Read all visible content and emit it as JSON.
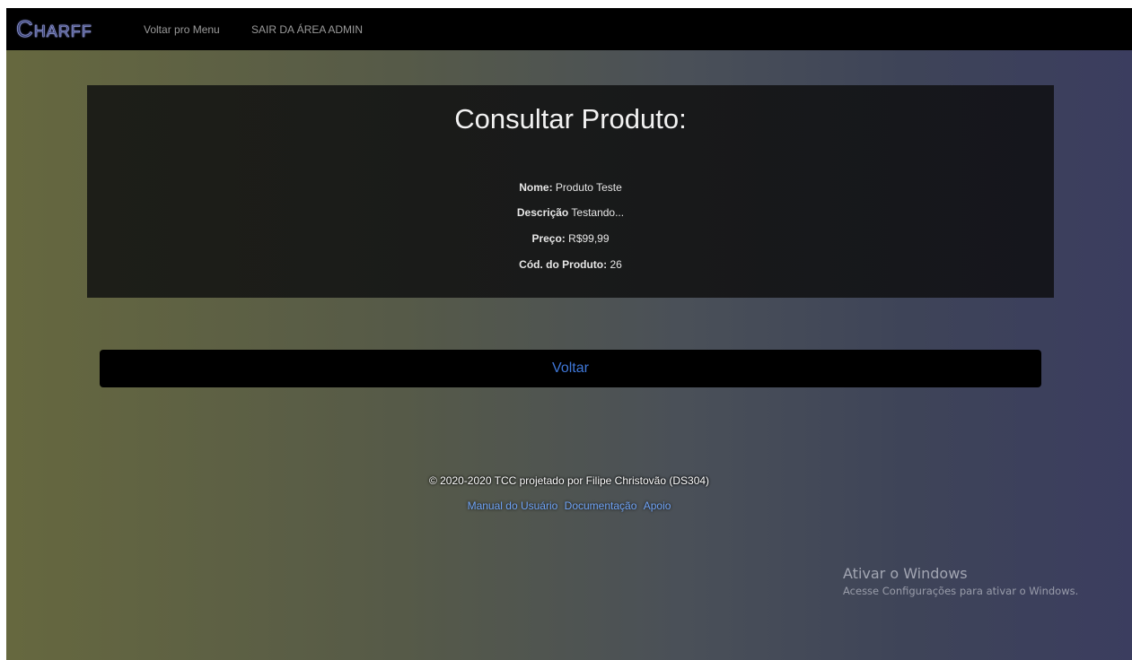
{
  "navbar": {
    "brand": "Charff",
    "links": [
      {
        "label": "Voltar pro Menu"
      },
      {
        "label": "SAIR DA ÁREA ADMIN"
      }
    ]
  },
  "product_card": {
    "title": "Consultar Produto:",
    "fields": [
      {
        "label": "Nome:",
        "value": "Produto Teste"
      },
      {
        "label": "Descrição",
        "value": "Testando..."
      },
      {
        "label": "Preço:",
        "value": "R$99,99"
      },
      {
        "label": "Cód. do Produto:",
        "value": "26"
      }
    ]
  },
  "back_button": {
    "label": "Voltar"
  },
  "footer": {
    "copyright": "© 2020-2020 TCC projetado por Filipe Christovão (DS304)",
    "links": [
      {
        "label": "Manual do Usuário"
      },
      {
        "label": "Documentação"
      },
      {
        "label": "Apoio"
      }
    ]
  },
  "windows_watermark": {
    "title": "Ativar o Windows",
    "subtitle": "Acesse Configurações para ativar o Windows."
  }
}
